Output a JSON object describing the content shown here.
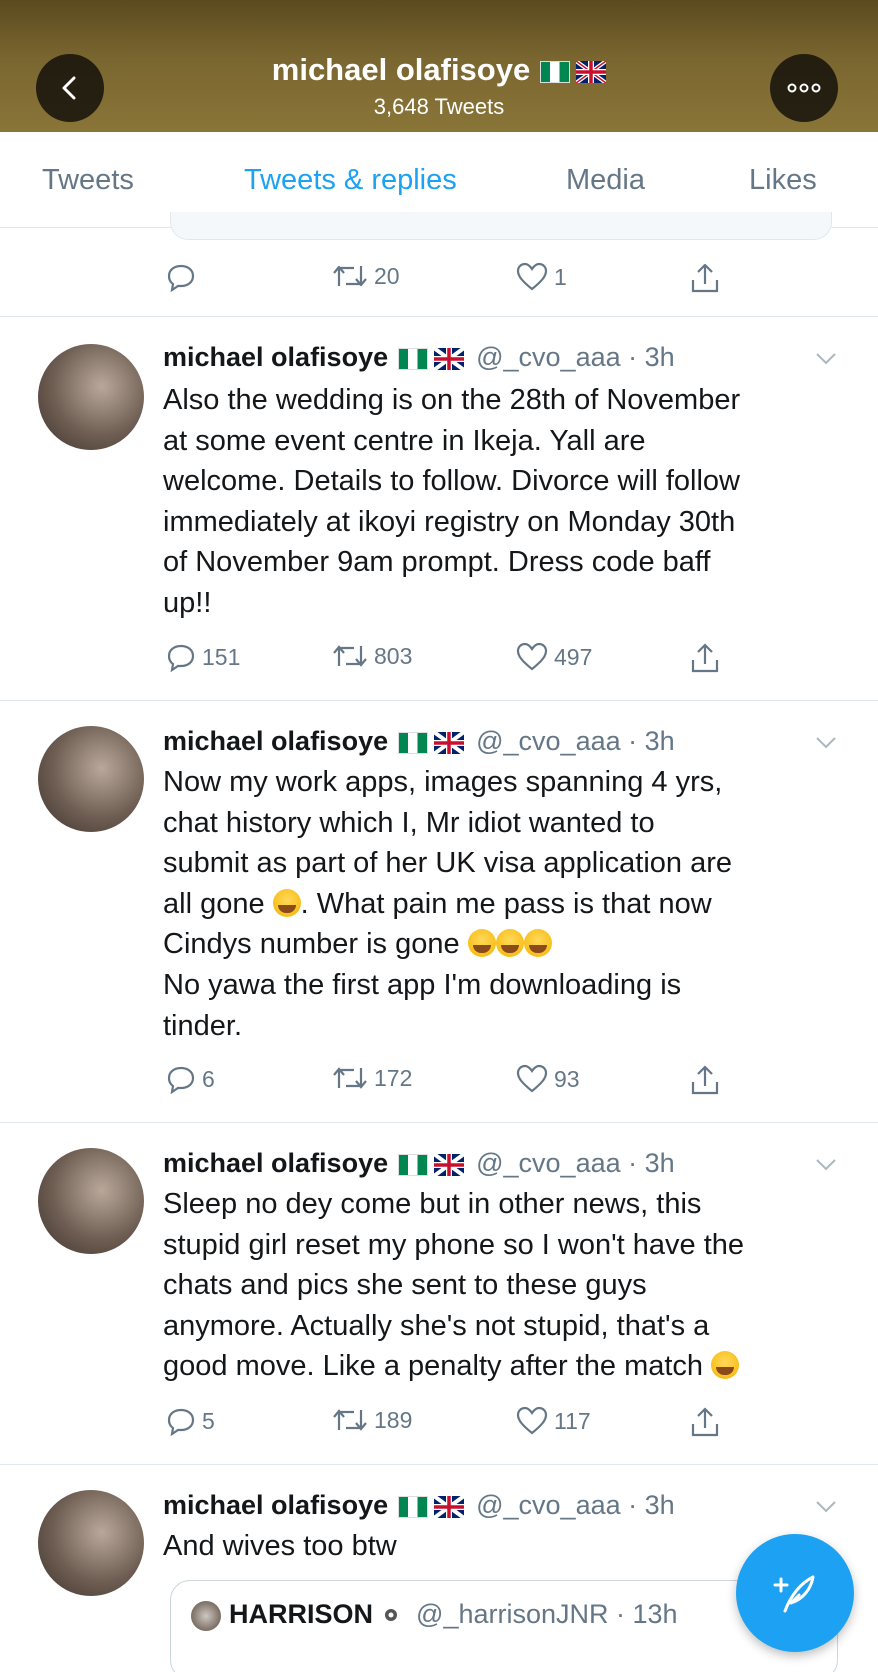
{
  "header": {
    "name": "michael olafisoye",
    "tweet_count": "3,648 Tweets",
    "back_icon": "chevron-left-icon",
    "more_icon": "more-dots-icon"
  },
  "tabs": [
    {
      "label": "Tweets",
      "active": false
    },
    {
      "label": "Tweets & replies",
      "active": true
    },
    {
      "label": "Media",
      "active": false
    },
    {
      "label": "Likes",
      "active": false
    }
  ],
  "previous_tweet_actions": {
    "replies": "",
    "retweets": "20",
    "likes": "1"
  },
  "tweets": [
    {
      "name": "michael olafisoye",
      "handle": "@_cvo_aaa · 3h",
      "lines": [
        "Also the wedding is on the 28th of November",
        "at some event centre in Ikeja. Yall are",
        "welcome. Details to follow. Divorce will follow",
        "immediately at ikoyi registry on Monday 30th",
        "of November 9am prompt. Dress code baff",
        "up!!"
      ],
      "replies": "151",
      "retweets": "803",
      "likes": "497"
    },
    {
      "name": "michael olafisoye",
      "handle": "@_cvo_aaa · 3h",
      "lines": [
        "Now my work apps, images spanning 4 yrs,",
        "chat history which I, Mr idiot wanted to",
        "submit as part of her UK visa application are",
        "all gone",
        ". What pain me pass is that now",
        "Cindys number is gone",
        "No yawa the first app I'm downloading is",
        "tinder."
      ],
      "replies": "6",
      "retweets": "172",
      "likes": "93"
    },
    {
      "name": "michael olafisoye",
      "handle": "@_cvo_aaa · 3h",
      "lines": [
        "Sleep no dey come but in other news, this",
        "stupid girl reset my phone so I won't have the",
        "chats and pics she sent to these guys",
        "anymore. Actually she's not stupid, that's a",
        "good move. Like a penalty after the match"
      ],
      "replies": "5",
      "retweets": "189",
      "likes": "117"
    },
    {
      "name": "michael olafisoye",
      "handle": "@_cvo_aaa · 3h",
      "lines": [
        "And wives too btw"
      ]
    }
  ],
  "quote": {
    "name": "HARRISON",
    "handle": "@_harrisonJNR · 13h"
  },
  "colors": {
    "accent": "#1da1f2",
    "secondary_text": "#657786",
    "divider": "#e1e8ed"
  },
  "fab_icon": "compose-feather-icon"
}
